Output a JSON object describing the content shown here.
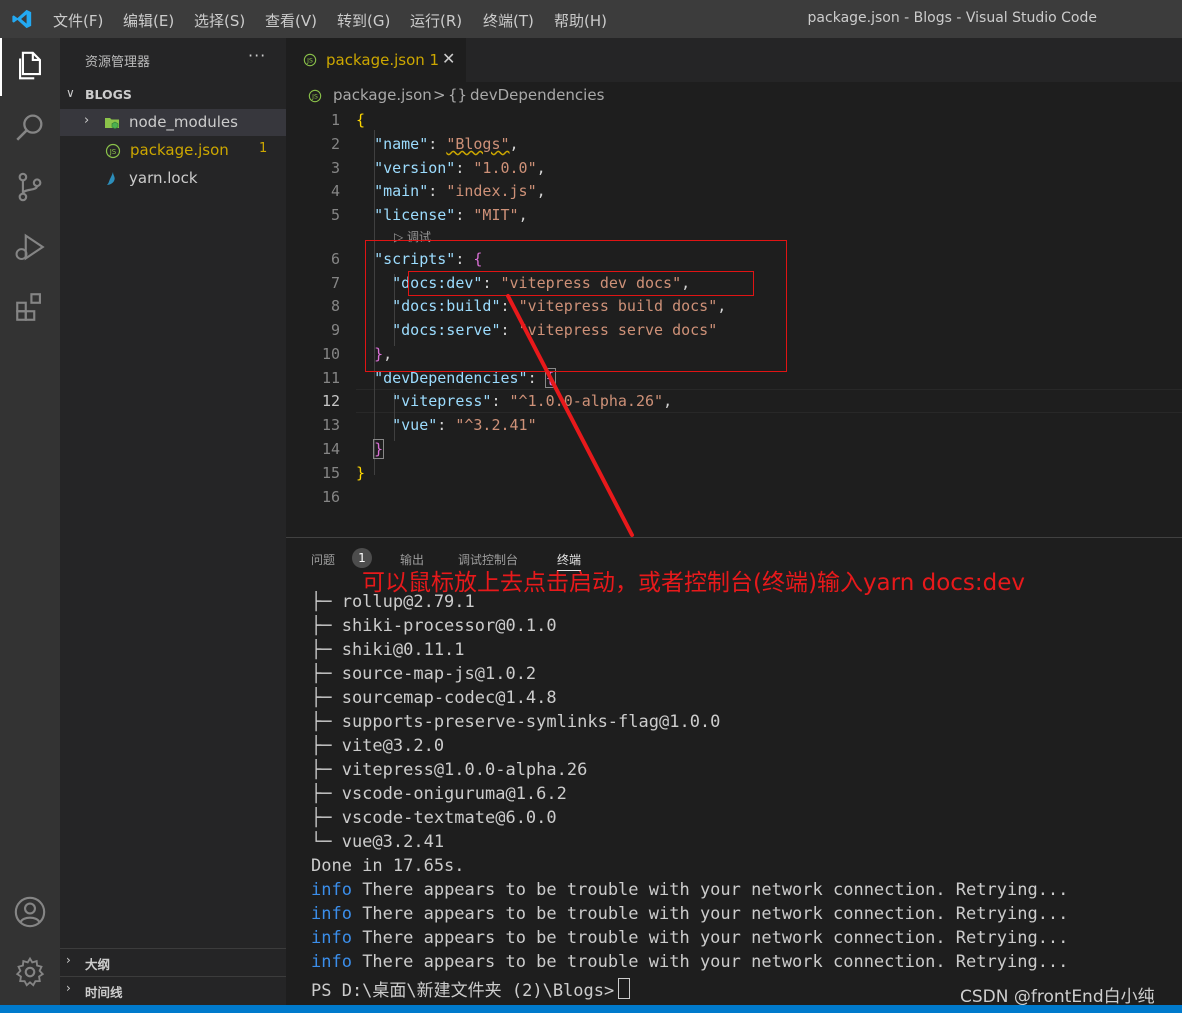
{
  "titlebar": {
    "menus": [
      "文件(F)",
      "编辑(E)",
      "选择(S)",
      "查看(V)",
      "转到(G)",
      "运行(R)",
      "终端(T)",
      "帮助(H)"
    ],
    "window_title": "package.json - Blogs - Visual Studio Code"
  },
  "activity": {
    "icons": [
      "files-icon",
      "search-icon",
      "source-control-icon",
      "run-debug-icon",
      "extensions-icon",
      "account-icon",
      "settings-gear-icon"
    ]
  },
  "sidebar": {
    "title": "资源管理器",
    "more": "···",
    "folder": "BLOGS",
    "items": [
      {
        "name": "node_modules",
        "icon": "folder-node-icon"
      },
      {
        "name": "package.json",
        "badge": "1",
        "icon": "json-js-icon",
        "color": "#cca700"
      },
      {
        "name": "yarn.lock",
        "icon": "yarn-icon"
      }
    ],
    "outline": "大纲",
    "timeline": "时间线"
  },
  "editor": {
    "tab": {
      "name": "package.json",
      "problems": "1",
      "close": "✕"
    },
    "breadcrumb": {
      "file": "package.json",
      "separator": ">",
      "symbol_icon": "{}",
      "symbol": "devDependencies"
    },
    "line_numbers": [
      "1",
      "2",
      "3",
      "4",
      "5",
      "6",
      "7",
      "8",
      "9",
      "10",
      "11",
      "12",
      "13",
      "14",
      "15",
      "16"
    ],
    "current_line": "12",
    "codelens": "▷ 调试"
  },
  "panel": {
    "tabs": [
      "问题",
      "输出",
      "调试控制台",
      "终端"
    ],
    "problems_count": "1",
    "terminal_lines": [
      "├─ rollup@2.79.1",
      "├─ shiki-processor@0.1.0",
      "├─ shiki@0.11.1",
      "├─ source-map-js@1.0.2",
      "├─ sourcemap-codec@1.4.8",
      "├─ supports-preserve-symlinks-flag@1.0.0",
      "├─ vite@3.2.0",
      "├─ vitepress@1.0.0-alpha.26",
      "├─ vscode-oniguruma@1.6.2",
      "├─ vscode-textmate@6.0.0",
      "└─ vue@3.2.41",
      "Done in 17.65s."
    ],
    "info_label": "info",
    "info_message": " There appears to be trouble with your network connection. Retrying...",
    "prompt": "PS D:\\桌面\\新建文件夹 (2)\\Blogs>"
  },
  "annotation": {
    "text": "可以鼠标放上去点击启动，或者控制台(终端)输入yarn docs:dev",
    "color": "#e8191b"
  },
  "watermark": "CSDN @frontEnd白小纯"
}
